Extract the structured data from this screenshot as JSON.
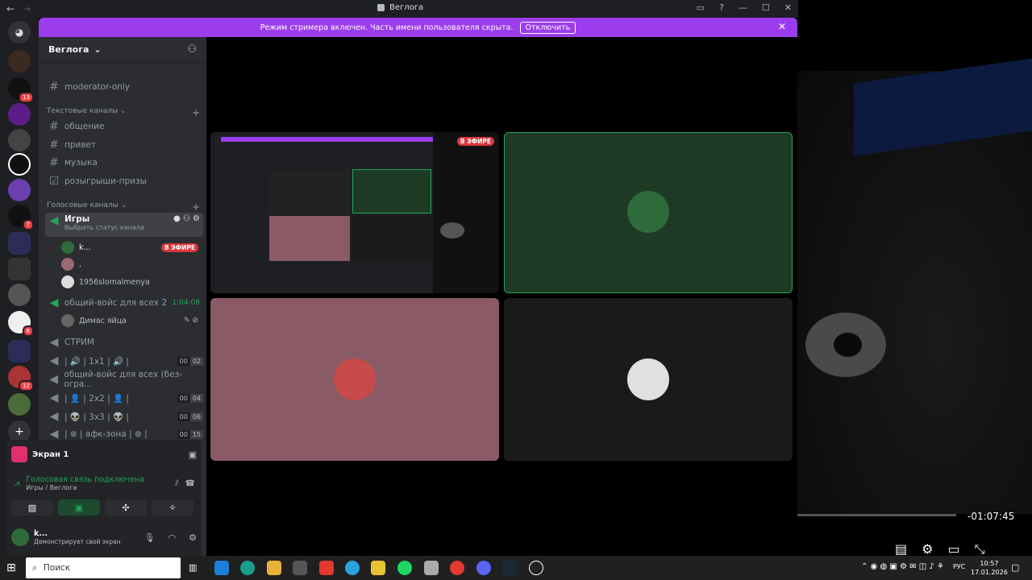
{
  "window": {
    "title": "Веглога"
  },
  "banner": {
    "text": "Режим стримера включен. Часть имени пользователя скрыта.",
    "button": "Отключить"
  },
  "server": {
    "name": "Веглога"
  },
  "channels": {
    "top": "moderator-only",
    "text_category": "Текстовые каналы",
    "text": [
      "общение",
      "привет",
      "музыка",
      "розыгрыши-призы"
    ],
    "voice_category": "Голосовые каналы",
    "voice_active": {
      "name": "Игры",
      "status": "Выбрать статус канала",
      "users": [
        "k...",
        ",",
        "1956slomalmenya"
      ],
      "live": "В ЭФИРЕ"
    },
    "voice2": {
      "name": "общий-войс для всех 2",
      "time": "1:04:08",
      "user": "Димас яйца"
    },
    "voice_list": [
      {
        "name": "СТРИМ",
        "a": "",
        "b": ""
      },
      {
        "name": "| 🔊 | 1x1 | 🔊 |",
        "a": "00",
        "b": "02"
      },
      {
        "name": "общий-войс для всех (без-огра...",
        "a": "",
        "b": ""
      },
      {
        "name": "| 👤 | 2x2 | 👤 |",
        "a": "00",
        "b": "04"
      },
      {
        "name": "| 👽 | 3x3 | 👽 |",
        "a": "00",
        "b": "06"
      },
      {
        "name": "| ⊗ | афк-зона | ⊗ |",
        "a": "00",
        "b": "15"
      }
    ]
  },
  "panel": {
    "screen": "Экран 1",
    "voice_connected": "Голосовая связь подключена",
    "voice_location": "Игры / Веглога",
    "username": "k...",
    "user_status": "Демонстрирует свой экран"
  },
  "stream": {
    "live_badge": "В ЭФИРЕ",
    "time": "-01:07:45"
  },
  "taskbar": {
    "search": "Поиск",
    "lang": "РУС",
    "time": "10:57",
    "date": "17.01.2026"
  },
  "colors": {
    "accent": "#9b3dec",
    "green_tile": "#1e3a25",
    "pink_tile": "#8a5a66",
    "live": "#da373c"
  }
}
